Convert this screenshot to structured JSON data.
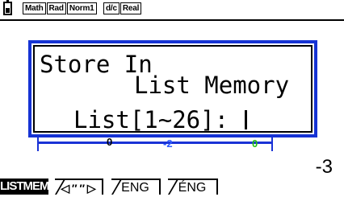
{
  "status_bar": {
    "badges": [
      "Math",
      "Rad",
      "Norm1",
      "d/c",
      "Real"
    ]
  },
  "dialog": {
    "line1": "Store In",
    "line2": "List Memory",
    "prompt": "List[1~26]: "
  },
  "plot": {
    "labels": [
      {
        "text": "0",
        "color": "#000000"
      },
      {
        "text": "-2",
        "color": "#2e5bff"
      },
      {
        "text": "0",
        "color": "#23c10e"
      }
    ],
    "readout": "-3",
    "axis_color": "#1a33d6"
  },
  "function_keys": [
    {
      "label": "LISTMEM",
      "active": true
    },
    {
      "label": "◁ ″ ″ ▷",
      "active": false
    },
    {
      "label": "ENG",
      "active": false
    },
    {
      "label": "ÉNG",
      "active": false
    }
  ],
  "colors": {
    "dialog_border": "#1633d4",
    "background": "#ffffff"
  }
}
